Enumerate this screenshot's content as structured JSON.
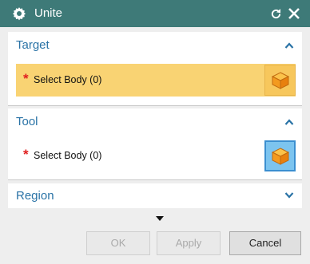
{
  "window": {
    "title": "Unite"
  },
  "panels": {
    "target": {
      "title": "Target",
      "select_label": "Select Body (0)",
      "required_mark": "*"
    },
    "tool": {
      "title": "Tool",
      "select_label": "Select Body (0)",
      "required_mark": "*"
    },
    "region": {
      "title": "Region"
    }
  },
  "buttons": {
    "ok": "OK",
    "apply": "Apply",
    "cancel": "Cancel"
  },
  "icons": {
    "title": "gear-icon",
    "reset": "reset-icon",
    "close": "close-icon",
    "collapse": "chevron-up-icon",
    "expand": "chevron-down-icon",
    "select": "cube-icon",
    "more": "more-options-icon"
  },
  "colors": {
    "titlebar": "#3e7a78",
    "section_title": "#2a73a6",
    "active_row": "#f9d373",
    "required": "#e02020",
    "tool_button": "#7cc4ef",
    "cube": "#f5a623"
  }
}
